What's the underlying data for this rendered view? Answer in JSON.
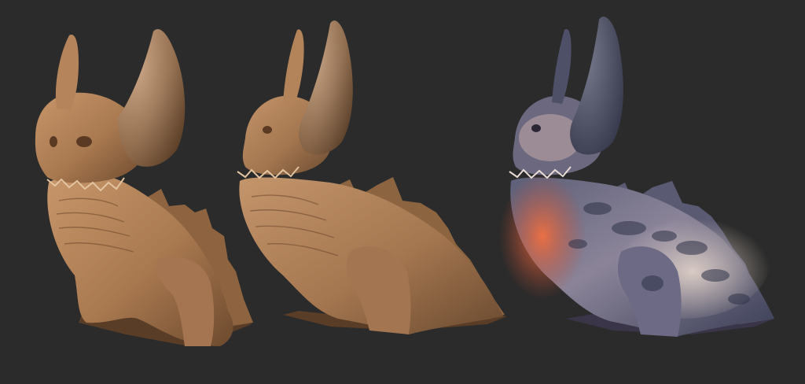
{
  "scene": {
    "background": "#2b2b2b"
  },
  "models": [
    {
      "label_name": "creature-sculpt-clay-front",
      "skin": "#a8784f",
      "skin_light": "#c8966a",
      "skin_dark": "#6d4a2e",
      "style": "clay"
    },
    {
      "label_name": "creature-sculpt-clay-angled",
      "skin": "#a57750",
      "skin_light": "#c4956b",
      "skin_dark": "#6a4a30",
      "style": "clay"
    },
    {
      "label_name": "creature-sculpt-painted",
      "skin": "#7d7890",
      "skin_light": "#e8d6c8",
      "skin_dark": "#3a3e56",
      "accent": "#e0643e",
      "style": "painted"
    }
  ]
}
